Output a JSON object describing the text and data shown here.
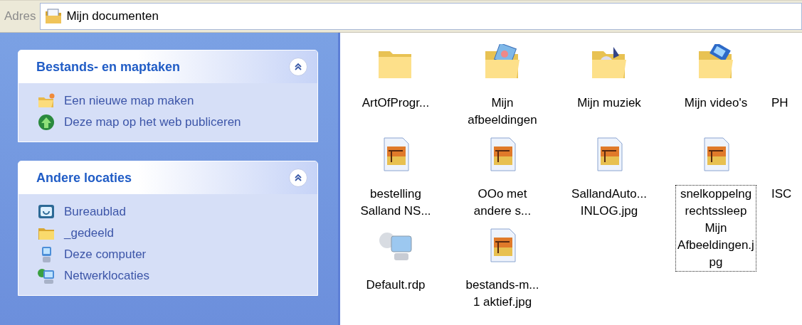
{
  "address_bar": {
    "label": "Adres",
    "value": "Mijn documenten"
  },
  "task_panels": [
    {
      "title": "Bestands- en maptaken",
      "expanded": true,
      "items": [
        {
          "label": "Een nieuwe map maken",
          "kind": "new-folder"
        },
        {
          "label": "Deze map op het web publiceren",
          "kind": "globe"
        }
      ]
    },
    {
      "title": "Andere locaties",
      "expanded": true,
      "items": [
        {
          "label": "Bureaublad",
          "kind": "desktop"
        },
        {
          "label": "_gedeeld",
          "kind": "folder"
        },
        {
          "label": "Deze computer",
          "kind": "computer"
        },
        {
          "label": "Netwerklocaties",
          "kind": "network"
        }
      ]
    }
  ],
  "files": [
    {
      "kind": "folder",
      "label_lines": [
        "ArtOfProgr..."
      ],
      "selected": false
    },
    {
      "kind": "pictures-folder",
      "label_lines": [
        "Mijn",
        "afbeeldingen"
      ],
      "selected": false
    },
    {
      "kind": "music-folder",
      "label_lines": [
        "Mijn muziek"
      ],
      "selected": false
    },
    {
      "kind": "video-folder",
      "label_lines": [
        "Mijn video's"
      ],
      "selected": false
    },
    {
      "kind": "cut-off",
      "label_lines": [
        "PH"
      ],
      "selected": false
    },
    {
      "kind": "image",
      "label_lines": [
        "bestelling",
        "Salland NS..."
      ],
      "selected": false
    },
    {
      "kind": "image",
      "label_lines": [
        "OOo met",
        "andere s..."
      ],
      "selected": false
    },
    {
      "kind": "image",
      "label_lines": [
        "SallandAuto...",
        "INLOG.jpg"
      ],
      "selected": false
    },
    {
      "kind": "image",
      "label_lines": [
        "snelkoppelng",
        "rechtssleep",
        "Mijn",
        "Afbeeldingen.j",
        "pg"
      ],
      "selected": true
    },
    {
      "kind": "cut-off",
      "label_lines": [
        "ISC"
      ],
      "selected": false
    },
    {
      "kind": "remote-desktop",
      "label_lines": [
        "Default.rdp"
      ],
      "selected": false
    },
    {
      "kind": "image",
      "label_lines": [
        "bestands-m...",
        "1 aktief.jpg"
      ],
      "selected": false
    }
  ]
}
